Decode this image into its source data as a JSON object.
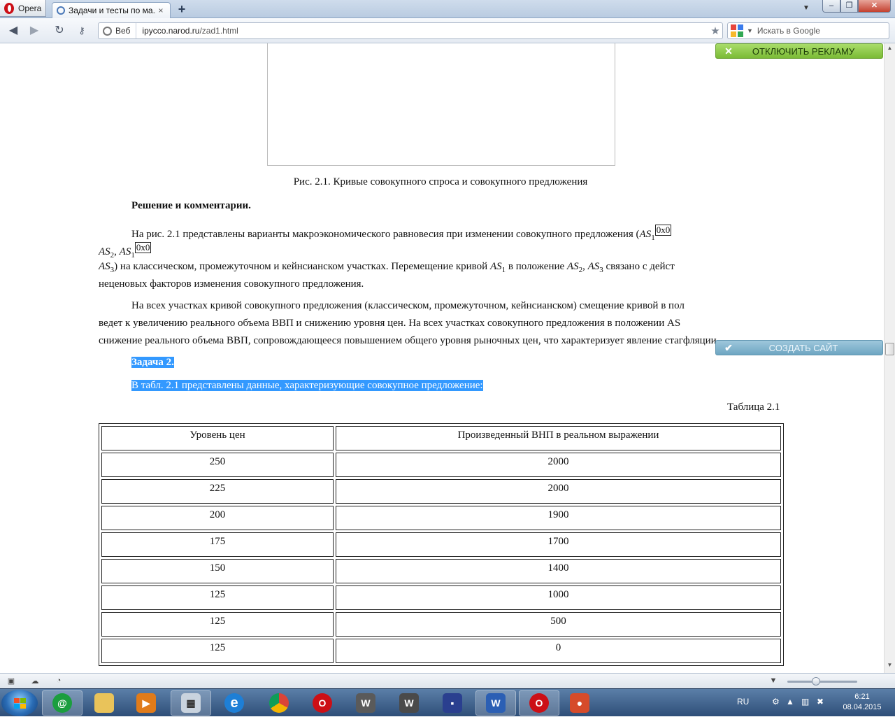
{
  "browser": {
    "menu_label": "Opera",
    "tab_title": "Задачи и тесты по ма...",
    "tab_close": "×",
    "new_tab": "+",
    "address": {
      "badge_label": "Веб",
      "host": "ipycco.narod.ru",
      "path": "/zad1.html"
    },
    "search_placeholder": "Искать в Google"
  },
  "ads": {
    "disable_label": "ОТКЛЮЧИТЬ РЕКЛАМУ",
    "create_label": "СОЗДАТЬ САЙТ"
  },
  "page": {
    "figure_caption": "Рис. 2.1. Кривые совокупного спроса и совокупного предложения",
    "solution_heading": "Решение и комментарии.",
    "para1": {
      "l1_text": "На рис. 2.1 представлены варианты макроэкономического равновесия при изменении совокупного предложения (",
      "as": "AS",
      "sub1": "1",
      "sub2": "2",
      "sub3": "3",
      "box": "0x0",
      "comma": ", ",
      "l3_text1": ") на классическом, промежуточном и кейнсианском участках. Перемещение кривой ",
      "l3_text2": " в положение ",
      "l3_text3": " связано с дейст",
      "l4": "неценовых факторов изменения совокупного предложения."
    },
    "para2": {
      "l1": "На всех участках кривой совокупного предложения (классическом, промежуточном, кейнсианском) смещение кривой в пол",
      "l2": "ведет к увеличению реального объема ВВП и снижению уровня цен. На всех участках совокупного предложения в положении AS",
      "l3": "снижение реального объема ВВП, сопровождающееся повышением общего уровня рыночных цен, что характеризует явление стагфляции"
    },
    "task_heading": "Задача 2.",
    "task_text": "В табл. 2.1 представлены данные, характеризующие совокупное предложение:",
    "table_title": "Таблица 2.1",
    "table": {
      "headers": [
        "Уровень цен",
        "Произведенный ВНП в реальном выражении"
      ],
      "rows": [
        [
          "250",
          "2000"
        ],
        [
          "225",
          "2000"
        ],
        [
          "200",
          "1900"
        ],
        [
          "175",
          "1700"
        ],
        [
          "150",
          "1400"
        ],
        [
          "125",
          "1000"
        ],
        [
          "125",
          "500"
        ],
        [
          "125",
          "0"
        ]
      ]
    }
  },
  "taskbar": {
    "lang": "RU",
    "time": "6:21",
    "date": "08.04.2015"
  }
}
